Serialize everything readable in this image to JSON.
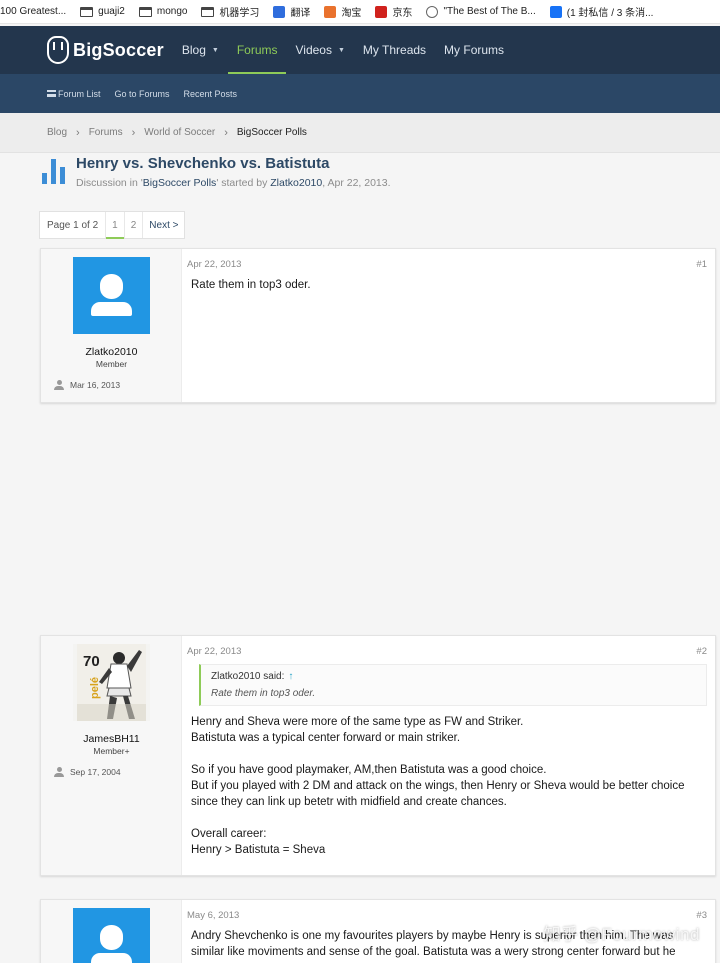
{
  "bookmarks": [
    {
      "label": "100 Greatest...",
      "icon": "none"
    },
    {
      "label": "guaji2",
      "icon": "folder-icon"
    },
    {
      "label": "mongo",
      "icon": "folder-icon"
    },
    {
      "label": "机器学习",
      "icon": "folder-icon"
    },
    {
      "label": "翻译",
      "icon": "translate-icon"
    },
    {
      "label": "淘宝",
      "icon": "taobao-icon"
    },
    {
      "label": "京东",
      "icon": "jd-icon"
    },
    {
      "label": "\"The Best of The B...",
      "icon": "globe-icon"
    },
    {
      "label": "(1 封私信 / 3 条消...",
      "icon": "zhihu-icon"
    }
  ],
  "header": {
    "logo_text": "BigSoccer",
    "nav": [
      {
        "label": "Blog",
        "dropdown": true,
        "active": false
      },
      {
        "label": "Forums",
        "dropdown": false,
        "active": true
      },
      {
        "label": "Videos",
        "dropdown": true,
        "active": false
      },
      {
        "label": "My Threads",
        "dropdown": false,
        "active": false
      },
      {
        "label": "My Forums",
        "dropdown": false,
        "active": false
      }
    ],
    "accent_color": "#8ecb58"
  },
  "subnav": {
    "forum_list": "Forum List",
    "go_to_forums": "Go to Forums",
    "recent_posts": "Recent Posts"
  },
  "breadcrumb": [
    "Blog",
    "Forums",
    "World of Soccer",
    "BigSoccer Polls"
  ],
  "thread": {
    "title": "Henry vs. Shevchenko vs. Batistuta",
    "meta_prefix": "Discussion in '",
    "forum": "BigSoccer Polls",
    "meta_mid": "' started by ",
    "author": "Zlatko2010",
    "date": ", Apr 22, 2013."
  },
  "pagination": {
    "label": "Page 1 of 2",
    "pages": [
      "1",
      "2"
    ],
    "current": "1",
    "next": "Next >"
  },
  "posts": [
    {
      "username": "Zlatko2010",
      "user_title": "Member",
      "joined": "Mar 16, 2013",
      "date": "Apr 22, 2013",
      "number": "#1",
      "body": [
        "Rate them in top3 oder."
      ]
    },
    {
      "username": "JamesBH11",
      "user_title": "Member+",
      "joined": "Sep 17, 2004",
      "date": "Apr 22, 2013",
      "number": "#2",
      "quote_author": "Zlatko2010 said:",
      "quote_arrow": "↑",
      "quote_text": "Rate them in top3 oder.",
      "body": [
        "Henry and Sheva were more of the same type as FW and Striker.",
        "Batistuta was a typical center forward or main striker.",
        "",
        "So if you have good playmaker, AM,then Batistuta was a good choice.",
        "But if you played with 2 DM and attack on the wings, then Henry or Sheva would be better choice",
        "since they can link up betetr with midfield and create chances.",
        "",
        "Overall career:",
        "Henry > Batistuta = Sheva"
      ]
    },
    {
      "username": "",
      "date": "May 6, 2013",
      "number": "#3",
      "body": [
        "Andry Shevchenko is one my favourites players by maybe Henry is superior then him. The was",
        "similar like moviments and sense of the goal. Batistuta was a wery strong center forward but he"
      ]
    }
  ],
  "watermark": "知乎 @Fourmowind"
}
